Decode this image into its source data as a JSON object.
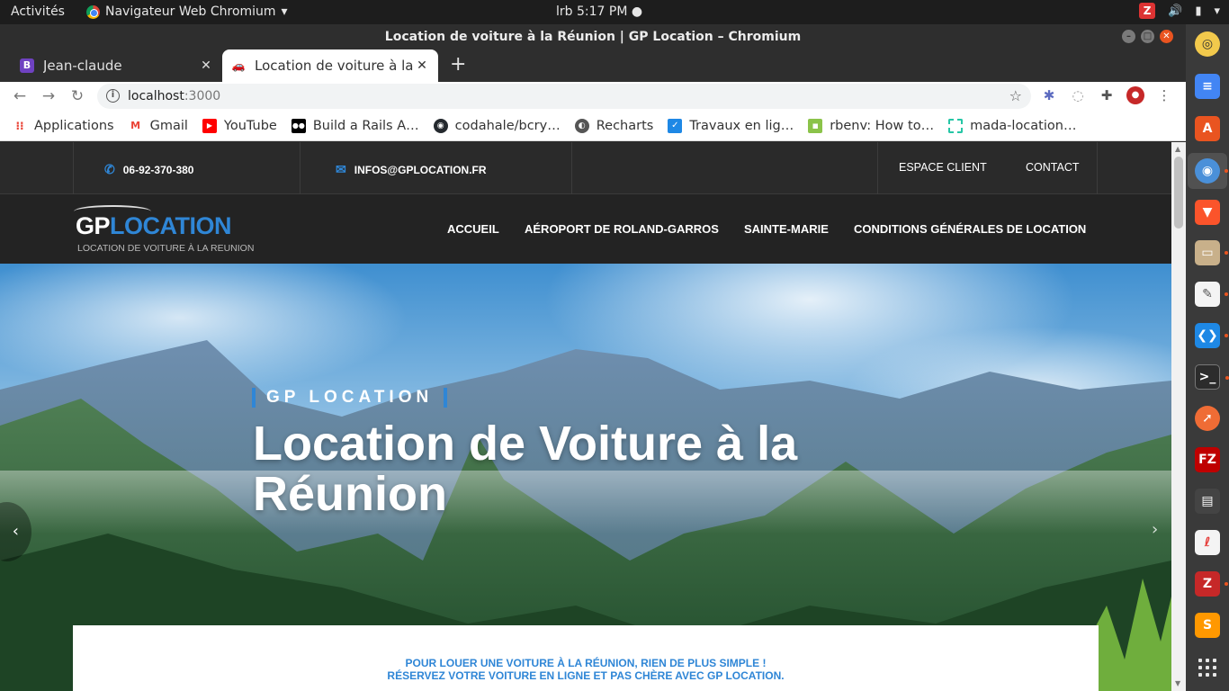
{
  "system_bar": {
    "activities": "Activités",
    "app_name": "Navigateur Web Chromium",
    "clock": "lrb   5:17 PM ●"
  },
  "window": {
    "title": "Location de voiture à la Réunion | GP Location – Chromium"
  },
  "tabs": [
    {
      "label": "Jean-claude",
      "favicon": "B"
    },
    {
      "label": "Location de voiture à la Réunion",
      "favicon": "car-icon"
    }
  ],
  "address_bar": {
    "host": "localhost",
    "port": ":3000"
  },
  "bookmarks": [
    {
      "label": "Applications",
      "icon": "apps-grid-icon",
      "color": "#e94235"
    },
    {
      "label": "Gmail",
      "icon": "gmail-icon",
      "color": "#ea4335"
    },
    {
      "label": "YouTube",
      "icon": "youtube-icon",
      "color": "#ff0000"
    },
    {
      "label": "Build a Rails A…",
      "icon": "medium-icon",
      "color": "#000000"
    },
    {
      "label": "codahale/bcry…",
      "icon": "github-icon",
      "color": "#24292e"
    },
    {
      "label": "Recharts",
      "icon": "globe-icon",
      "color": "#555555"
    },
    {
      "label": "Travaux en lig…",
      "icon": "flag-icon",
      "color": "#1e88e5"
    },
    {
      "label": "rbenv: How to…",
      "icon": "rbenv-icon",
      "color": "#8bc34a"
    },
    {
      "label": "mada-location…",
      "icon": "page-icon",
      "color": "#26c6a6"
    }
  ],
  "site": {
    "phone": "06-92-370-380",
    "email": "INFOS@GPLOCATION.FR",
    "top_links": {
      "client": "ESPACE CLIENT",
      "contact": "CONTACT"
    },
    "logo": {
      "gp": "GP",
      "location": "LOCATION",
      "tagline": "LOCATION DE VOITURE À LA REUNION"
    },
    "menu": {
      "home": "ACCUEIL",
      "airport": "AÉROPORT DE ROLAND-GARROS",
      "sainte_marie": "SAINTE-MARIE",
      "terms": "CONDITIONS GÉNÉRALES DE LOCATION"
    },
    "hero": {
      "kicker": "GP LOCATION",
      "title": "Location de Voiture à la Réunion"
    },
    "intro": {
      "line1": "POUR LOUER UNE VOITURE À LA RÉUNION, RIEN DE PLUS SIMPLE !",
      "line2": "RÉSERVEZ VOTRE VOITURE EN LIGNE ET PAS CHÈRE AVEC GP LOCATION."
    },
    "accent_color": "#2f86d6"
  },
  "dock": [
    {
      "name": "rhythmbox-icon",
      "color": "#f2c94c"
    },
    {
      "name": "docs-icon",
      "color": "#4285f4"
    },
    {
      "name": "software-center-icon",
      "color": "#e95420"
    },
    {
      "name": "chromium-icon",
      "color": "#4a90d9"
    },
    {
      "name": "brave-icon",
      "color": "#fb542b"
    },
    {
      "name": "files-icon",
      "color": "#c8b08a"
    },
    {
      "name": "text-editor-icon",
      "color": "#f4f4f4"
    },
    {
      "name": "vscode-icon",
      "color": "#1e88e5"
    },
    {
      "name": "terminal-icon",
      "color": "#2c2c2c"
    },
    {
      "name": "postman-icon",
      "color": "#ef6c35"
    },
    {
      "name": "filezilla-icon",
      "color": "#bf0000"
    },
    {
      "name": "video-editor-icon",
      "color": "#444444"
    },
    {
      "name": "lin-icon",
      "color": "#e53935"
    },
    {
      "name": "zeal-icon",
      "color": "#c62828"
    },
    {
      "name": "sublime-icon",
      "color": "#ff9800"
    }
  ]
}
